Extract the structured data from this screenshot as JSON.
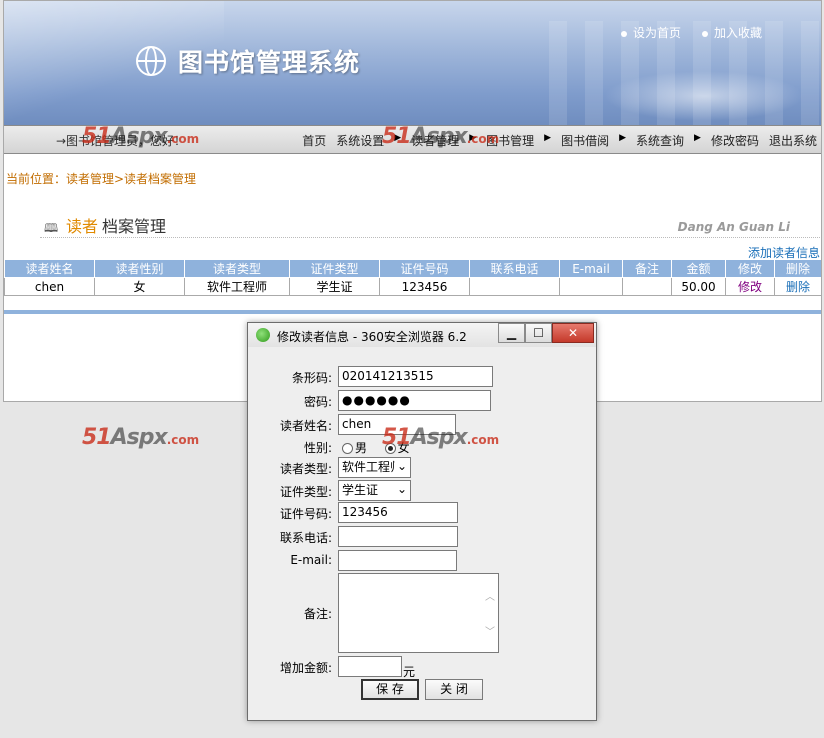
{
  "header": {
    "system_title": "图书馆管理系统",
    "set_home": "设为首页",
    "add_favorite": "加入收藏"
  },
  "navbar": {
    "welcome": "→图书馆管理员，您好！",
    "items": [
      "首页",
      "系统设置",
      "读者管理",
      "图书管理",
      "图书借阅",
      "系统查询",
      "修改密码",
      "退出系统"
    ]
  },
  "breadcrumb": "当前位置：读者管理>读者档案管理",
  "section": {
    "title_highlight": "读者",
    "title_rest": "档案管理",
    "pinyin": "Dang An Guan Li",
    "add_link": "添加读者信息"
  },
  "table": {
    "headers": [
      "读者姓名",
      "读者性别",
      "读者类型",
      "证件类型",
      "证件号码",
      "联系电话",
      "E-mail",
      "备注",
      "金额",
      "修改",
      "删除"
    ],
    "rows": [
      [
        "chen",
        "女",
        "软件工程师",
        "学生证",
        "123456",
        "",
        "",
        "",
        "50.00",
        "修改",
        "删除"
      ]
    ]
  },
  "watermark": {
    "part1": "51",
    "part2": "Aspx",
    "part3": ".com"
  },
  "dialog": {
    "title": "修改读者信息 - 360安全浏览器 6.2",
    "minimize": "▁",
    "maximize": "☐",
    "close": "✕",
    "fields": {
      "barcode_label": "条形码:",
      "barcode_value": "020141213515",
      "password_label": "密码:",
      "password_value": "●●●●●●",
      "name_label": "读者姓名:",
      "name_value": "chen",
      "gender_label": "性别:",
      "gender_male": "男",
      "gender_female": "女",
      "gender_selected": "女",
      "reader_type_label": "读者类型:",
      "reader_type_value": "软件工程师",
      "id_type_label": "证件类型:",
      "id_type_value": "学生证",
      "id_number_label": "证件号码:",
      "id_number_value": "123456",
      "phone_label": "联系电话:",
      "phone_value": "",
      "email_label": "E-mail:",
      "email_value": "",
      "remark_label": "备注:",
      "remark_value": "",
      "amount_label": "增加金额:",
      "amount_value": "",
      "amount_unit": "元"
    },
    "save_button": "保 存",
    "close_button": "关 闭"
  }
}
